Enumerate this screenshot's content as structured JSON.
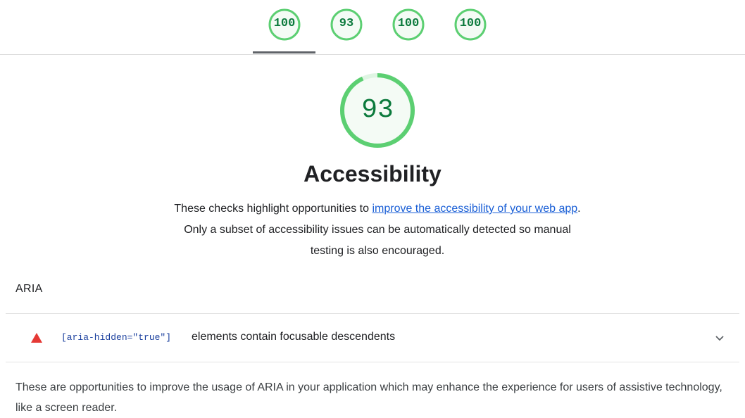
{
  "tabs": [
    {
      "score": "100",
      "value": 100
    },
    {
      "score": "93",
      "value": 93
    },
    {
      "score": "100",
      "value": 100
    },
    {
      "score": "100",
      "value": 100
    }
  ],
  "category": {
    "score": "93",
    "value": 93,
    "title": "Accessibility",
    "description_pre": "These checks highlight opportunities to ",
    "description_link": "improve the accessibility of your web app",
    "description_post": ". Only a subset of accessibility issues can be automatically detected so manual testing is also encouraged."
  },
  "group": {
    "title": "ARIA",
    "audit": {
      "code": "[aria-hidden=\"true\"]",
      "text": "elements contain focusable descendents"
    },
    "description": "These are opportunities to improve the usage of ARIA in your application which may enhance the experience for users of assistive technology, like a screen reader."
  },
  "colors": {
    "pass_ring": "#5ccf72",
    "pass_ring_track": "#dff5e3",
    "pass_text": "#0b7a3c",
    "fail_icon": "#e53935",
    "link": "#1a5fd6"
  },
  "icons": {
    "audit_status": "warning-triangle-icon",
    "expand": "chevron-down-icon"
  }
}
